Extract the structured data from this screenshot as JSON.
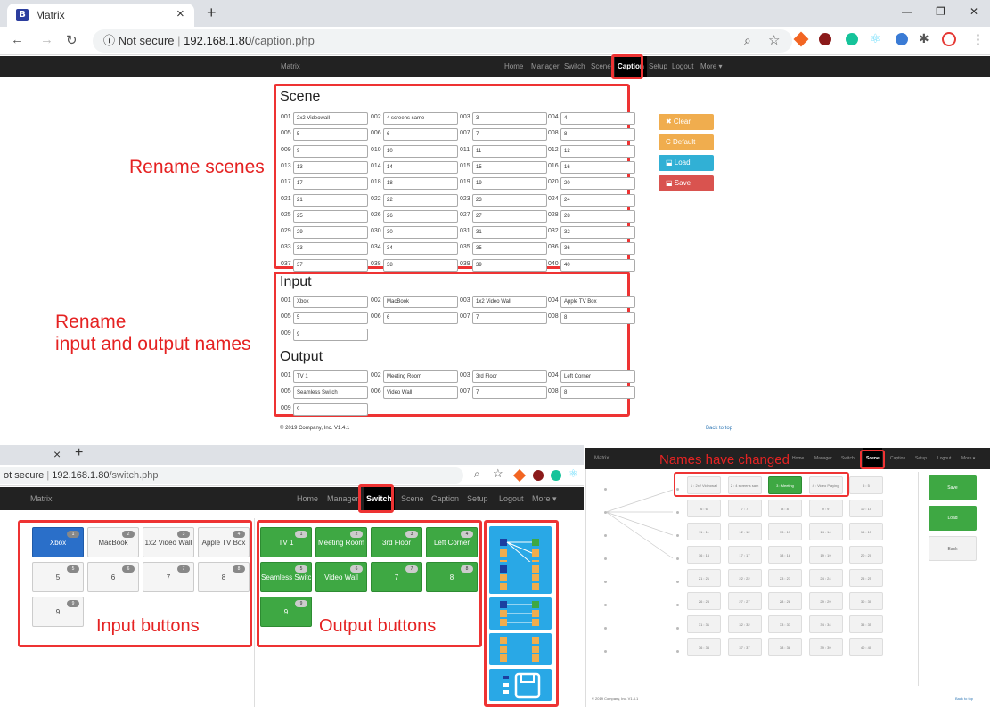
{
  "browser": {
    "tab_title": "Matrix",
    "tab_close": "×",
    "new_tab": "+",
    "not_secure": "Not secure",
    "url_host": "192.168.1.80",
    "url_path": "/caption.php",
    "favicon_letter": "B",
    "win_min": "—",
    "win_restore": "❐",
    "win_close": "✕"
  },
  "caption_page": {
    "brand": "Matrix",
    "nav": [
      "Home",
      "Manager",
      "Switch",
      "Scene",
      "Caption",
      "Setup",
      "Logout",
      "More ▾"
    ],
    "active_nav": "Caption",
    "scene_title": "Scene",
    "scenes": [
      {
        "num": "001",
        "val": "2x2 Videowall"
      },
      {
        "num": "002",
        "val": "4 screens same"
      },
      {
        "num": "003",
        "val": "3"
      },
      {
        "num": "004",
        "val": "4"
      },
      {
        "num": "005",
        "val": "5"
      },
      {
        "num": "006",
        "val": "6"
      },
      {
        "num": "007",
        "val": "7"
      },
      {
        "num": "008",
        "val": "8"
      },
      {
        "num": "009",
        "val": "9"
      },
      {
        "num": "010",
        "val": "10"
      },
      {
        "num": "011",
        "val": "11"
      },
      {
        "num": "012",
        "val": "12"
      },
      {
        "num": "013",
        "val": "13"
      },
      {
        "num": "014",
        "val": "14"
      },
      {
        "num": "015",
        "val": "15"
      },
      {
        "num": "016",
        "val": "16"
      },
      {
        "num": "017",
        "val": "17"
      },
      {
        "num": "018",
        "val": "18"
      },
      {
        "num": "019",
        "val": "19"
      },
      {
        "num": "020",
        "val": "20"
      },
      {
        "num": "021",
        "val": "21"
      },
      {
        "num": "022",
        "val": "22"
      },
      {
        "num": "023",
        "val": "23"
      },
      {
        "num": "024",
        "val": "24"
      },
      {
        "num": "025",
        "val": "25"
      },
      {
        "num": "026",
        "val": "26"
      },
      {
        "num": "027",
        "val": "27"
      },
      {
        "num": "028",
        "val": "28"
      },
      {
        "num": "029",
        "val": "29"
      },
      {
        "num": "030",
        "val": "30"
      },
      {
        "num": "031",
        "val": "31"
      },
      {
        "num": "032",
        "val": "32"
      },
      {
        "num": "033",
        "val": "33"
      },
      {
        "num": "034",
        "val": "34"
      },
      {
        "num": "035",
        "val": "35"
      },
      {
        "num": "036",
        "val": "36"
      },
      {
        "num": "037",
        "val": "37"
      },
      {
        "num": "038",
        "val": "38"
      },
      {
        "num": "039",
        "val": "39"
      },
      {
        "num": "040",
        "val": "40"
      }
    ],
    "input_title": "Input",
    "inputs": [
      {
        "num": "001",
        "val": "Xbox"
      },
      {
        "num": "002",
        "val": "MacBook"
      },
      {
        "num": "003",
        "val": "1x2 Video Wall"
      },
      {
        "num": "004",
        "val": "Apple TV Box"
      },
      {
        "num": "005",
        "val": "5"
      },
      {
        "num": "006",
        "val": "6"
      },
      {
        "num": "007",
        "val": "7"
      },
      {
        "num": "008",
        "val": "8"
      },
      {
        "num": "009",
        "val": "9"
      }
    ],
    "output_title": "Output",
    "outputs": [
      {
        "num": "001",
        "val": "TV 1"
      },
      {
        "num": "002",
        "val": "Meeting Room"
      },
      {
        "num": "003",
        "val": "3rd Floor"
      },
      {
        "num": "004",
        "val": "Left Corner"
      },
      {
        "num": "005",
        "val": "Seamless Switch"
      },
      {
        "num": "006",
        "val": "Video Wall"
      },
      {
        "num": "007",
        "val": "7"
      },
      {
        "num": "008",
        "val": "8"
      },
      {
        "num": "009",
        "val": "9"
      }
    ],
    "actions": [
      {
        "label": "✖ Clear",
        "color": "#f0ad4e"
      },
      {
        "label": "C Default",
        "color": "#f0ad4e"
      },
      {
        "label": "⬓ Load",
        "color": "#31b0d5"
      },
      {
        "label": "⬓ Save",
        "color": "#d9534f"
      }
    ],
    "footer": "© 2019 Company, Inc. V1.4.1",
    "back_to_top": "Back to top"
  },
  "annotations": {
    "rename_scenes": "Rename scenes",
    "rename_io_line1": "Rename",
    "rename_io_line2": "input and output names",
    "input_buttons": "Input buttons",
    "output_buttons": "Output buttons",
    "names_changed": "Names have changed"
  },
  "switch_page": {
    "tab_close": "×",
    "new_tab": "+",
    "url_prefix": "ot secure",
    "url_host": "192.168.1.80",
    "url_path": "/switch.php",
    "brand": "Matrix",
    "nav": [
      "Home",
      "Manager",
      "Switch",
      "Scene",
      "Caption",
      "Setup",
      "Logout",
      "More ▾"
    ],
    "active_nav": "Switch",
    "inputs": [
      {
        "label": "Xbox",
        "n": "1"
      },
      {
        "label": "MacBook",
        "n": "2"
      },
      {
        "label": "1x2 Video Wall",
        "n": "3"
      },
      {
        "label": "Apple TV Box",
        "n": "4"
      },
      {
        "label": "5",
        "n": "5"
      },
      {
        "label": "6",
        "n": "6"
      },
      {
        "label": "7",
        "n": "7"
      },
      {
        "label": "8",
        "n": "8"
      },
      {
        "label": "9",
        "n": "9"
      }
    ],
    "outputs": [
      {
        "label": "TV 1",
        "n": "1"
      },
      {
        "label": "Meeting Room",
        "n": "2"
      },
      {
        "label": "3rd Floor",
        "n": "3"
      },
      {
        "label": "Left Corner",
        "n": "4"
      },
      {
        "label": "Seamless Switc",
        "n": "5"
      },
      {
        "label": "Video Wall",
        "n": "6"
      },
      {
        "label": "7",
        "n": "7"
      },
      {
        "label": "8",
        "n": "8"
      },
      {
        "label": "9",
        "n": "9"
      }
    ]
  },
  "scene_page": {
    "brand": "Matrix",
    "nav": [
      "Home",
      "Manager",
      "Switch",
      "Scene",
      "Caption",
      "Setup",
      "Logout",
      "More ▾"
    ],
    "active_nav": "Scene",
    "scenes": [
      "1 : 2x2 Videowall",
      "2 : 4 screens sam",
      "3 : Meeting",
      "4 : Video Playing",
      "5 : 5",
      "6 : 6",
      "7 : 7",
      "8 : 8",
      "9 : 9",
      "10 : 10",
      "11 : 11",
      "12 : 12",
      "13 : 13",
      "14 : 14",
      "15 : 15",
      "16 : 16",
      "17 : 17",
      "18 : 18",
      "19 : 19",
      "20 : 20",
      "21 : 21",
      "22 : 22",
      "23 : 23",
      "24 : 24",
      "25 : 25",
      "26 : 26",
      "27 : 27",
      "28 : 28",
      "29 : 29",
      "30 : 30",
      "31 : 31",
      "32 : 32",
      "33 : 33",
      "34 : 34",
      "35 : 35",
      "36 : 36",
      "37 : 37",
      "38 : 38",
      "39 : 39",
      "40 : 40"
    ],
    "selected_scene": "3 : Meeting",
    "buttons": [
      "Save",
      "Load",
      "Back"
    ],
    "footer": "© 2019 Company, Inc. V1.4.1",
    "back_to_top": "Back to top"
  }
}
